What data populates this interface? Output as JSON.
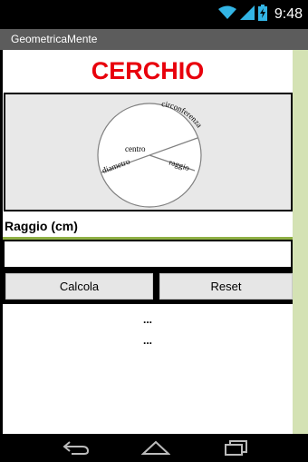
{
  "status_bar": {
    "time": "9:48",
    "icons": [
      "wifi-icon",
      "cell-signal-icon",
      "battery-icon"
    ]
  },
  "app": {
    "title": "GeometricaMente"
  },
  "header": {
    "title": "CERCHIO",
    "title_color": "#e8000c"
  },
  "figure": {
    "labels": {
      "circumference": "circonferenza",
      "center": "centro",
      "diameter": "diametro",
      "radius": "raggio"
    }
  },
  "form": {
    "radius_label": "Raggio (cm)",
    "radius_value": "",
    "calculate_button": "Calcola",
    "reset_button": "Reset"
  },
  "results": {
    "line1": "...",
    "line2": "..."
  },
  "colors": {
    "accent": "#8fb045",
    "scrollbar": "#d4e2b4",
    "titlebar": "#5c5c5c"
  },
  "navigation": {
    "icons": [
      "back-icon",
      "home-icon",
      "recent-apps-icon"
    ]
  }
}
